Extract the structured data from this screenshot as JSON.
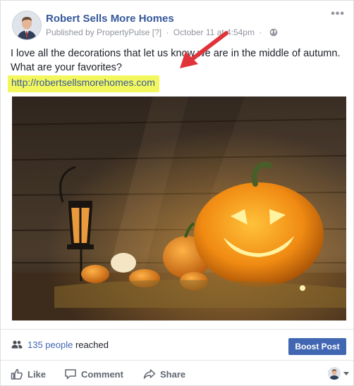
{
  "post": {
    "page_name": "Robert Sells More Homes",
    "published_by_label": "Published by PropertyPulse",
    "help_marker": "[?]",
    "separator": "·",
    "date": "October 11 at 4:54pm",
    "text": "I love all the decorations that let us know we are in the middle of autumn. What are your favorites?",
    "link": "http://robertsellsmorehomes.com",
    "highlight_color": "#f3f75e",
    "arrow_color": "#e0333a"
  },
  "reach": {
    "count": "135 people",
    "suffix": " reached",
    "boost_label": "Boost Post"
  },
  "actions": {
    "like": "Like",
    "comment": "Comment",
    "share": "Share"
  },
  "icons": [
    "avatar",
    "more-options-icon",
    "globe-icon",
    "arrow-annotation",
    "people-icon",
    "thumbs-up-icon",
    "comment-icon",
    "share-icon",
    "chevron-down-icon"
  ],
  "colors": {
    "brand": "#365899",
    "button": "#4267b2"
  }
}
